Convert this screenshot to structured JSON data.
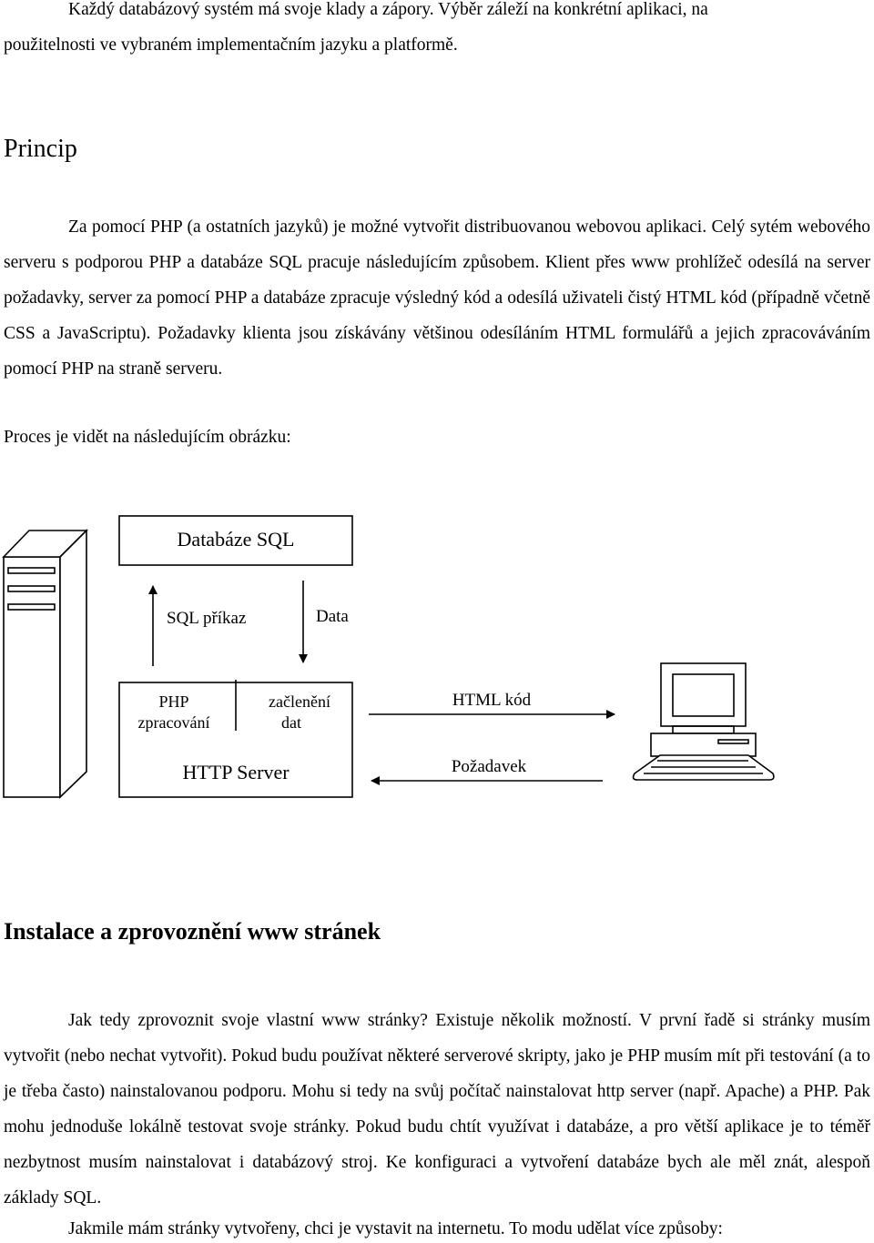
{
  "paragraphs": {
    "intro_line1": "Každý databázový systém má svoje klady a zápory. Výběr záleží na konkrétní aplikaci, na",
    "intro_line2": "použitelnosti ve vybraném implementačním jazyku a platformě.",
    "princip_heading": "Princip",
    "princip_text": "Za pomocí PHP (a ostatních jazyků) je možné vytvořit distribuovanou webovou aplikaci. Celý sytém webového serveru s podporou PHP a databáze SQL pracuje následujícím způsobem. Klient přes www prohlížeč odesílá na server požadavky, server za pomocí PHP a databáze zpracuje výsledný kód a odesílá uživateli čistý HTML kód (případně včetně CSS a JavaScriptu). Požadavky klienta jsou získávány většinou odesíláním HTML formulářů a jejich zpracováváním pomocí PHP na straně serveru.",
    "proces_text": "Proces je vidět na následujícím obrázku:",
    "install_heading": "Instalace a zprovoznění www stránek",
    "install_text": "Jak tedy zprovoznit svoje vlastní www stránky? Existuje několik možností. V první řadě si stránky musím vytvořit (nebo nechat vytvořit). Pokud budu používat některé serverové skripty, jako je PHP musím mít při testování (a to je třeba často) nainstalovanou podporu. Mohu si tedy na svůj počítač nainstalovat http server (např. Apache) a PHP. Pak mohu jednoduše lokálně testovat svoje stránky. Pokud budu chtít využívat i databáze, a pro větší aplikace je to téměř nezbytnost musím nainstalovat i databázový stroj. Ke konfiguraci a vytvoření databáze bych ale měl znát, alespoň základy SQL.",
    "last_line": "Jakmile mám stránky vytvořeny, chci je vystavit na internetu. To modu udělat více způsoby:"
  },
  "diagram": {
    "database_box": "Databáze SQL",
    "sql_command_label": "SQL příkaz",
    "data_label": "Data",
    "php_label_line1": "PHP",
    "php_label_line2": "zpracování",
    "integration_line1": "začlenění",
    "integration_line2": "dat",
    "http_server_label": "HTTP Server",
    "html_code_label": "HTML kód",
    "request_label": "Požadavek",
    "server_icon": "server-tower-icon",
    "client_icon": "desktop-computer-icon"
  }
}
